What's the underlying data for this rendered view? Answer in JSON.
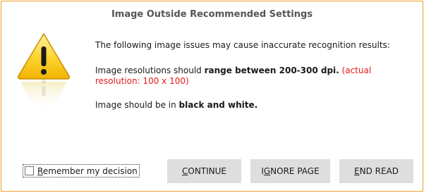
{
  "dialog": {
    "title": "Image Outside Recommended Settings",
    "accent_border_color": "#f0a030"
  },
  "message": {
    "intro": "The following image issues may cause inaccurate recognition results:",
    "resolution_prefix": "Image resolutions should ",
    "resolution_bold": "range between 200-300  dpi.",
    "resolution_actual": " (actual resolution: 100 x 100)",
    "bw_prefix": "Image should be in ",
    "bw_bold": "black and white."
  },
  "icon": {
    "name": "warning-icon"
  },
  "remember": {
    "checked": false,
    "label_underlined": "R",
    "label_rest": "emember my decision"
  },
  "buttons": {
    "continue": {
      "mnemonic": "C",
      "rest": "ONTINUE"
    },
    "ignore_page": {
      "pre": "I",
      "mnemonic": "G",
      "rest": "NORE PAGE"
    },
    "end_read": {
      "mnemonic": "E",
      "rest": "ND READ"
    }
  },
  "colors": {
    "error_text": "#e81818",
    "button_bg": "#dedede"
  }
}
